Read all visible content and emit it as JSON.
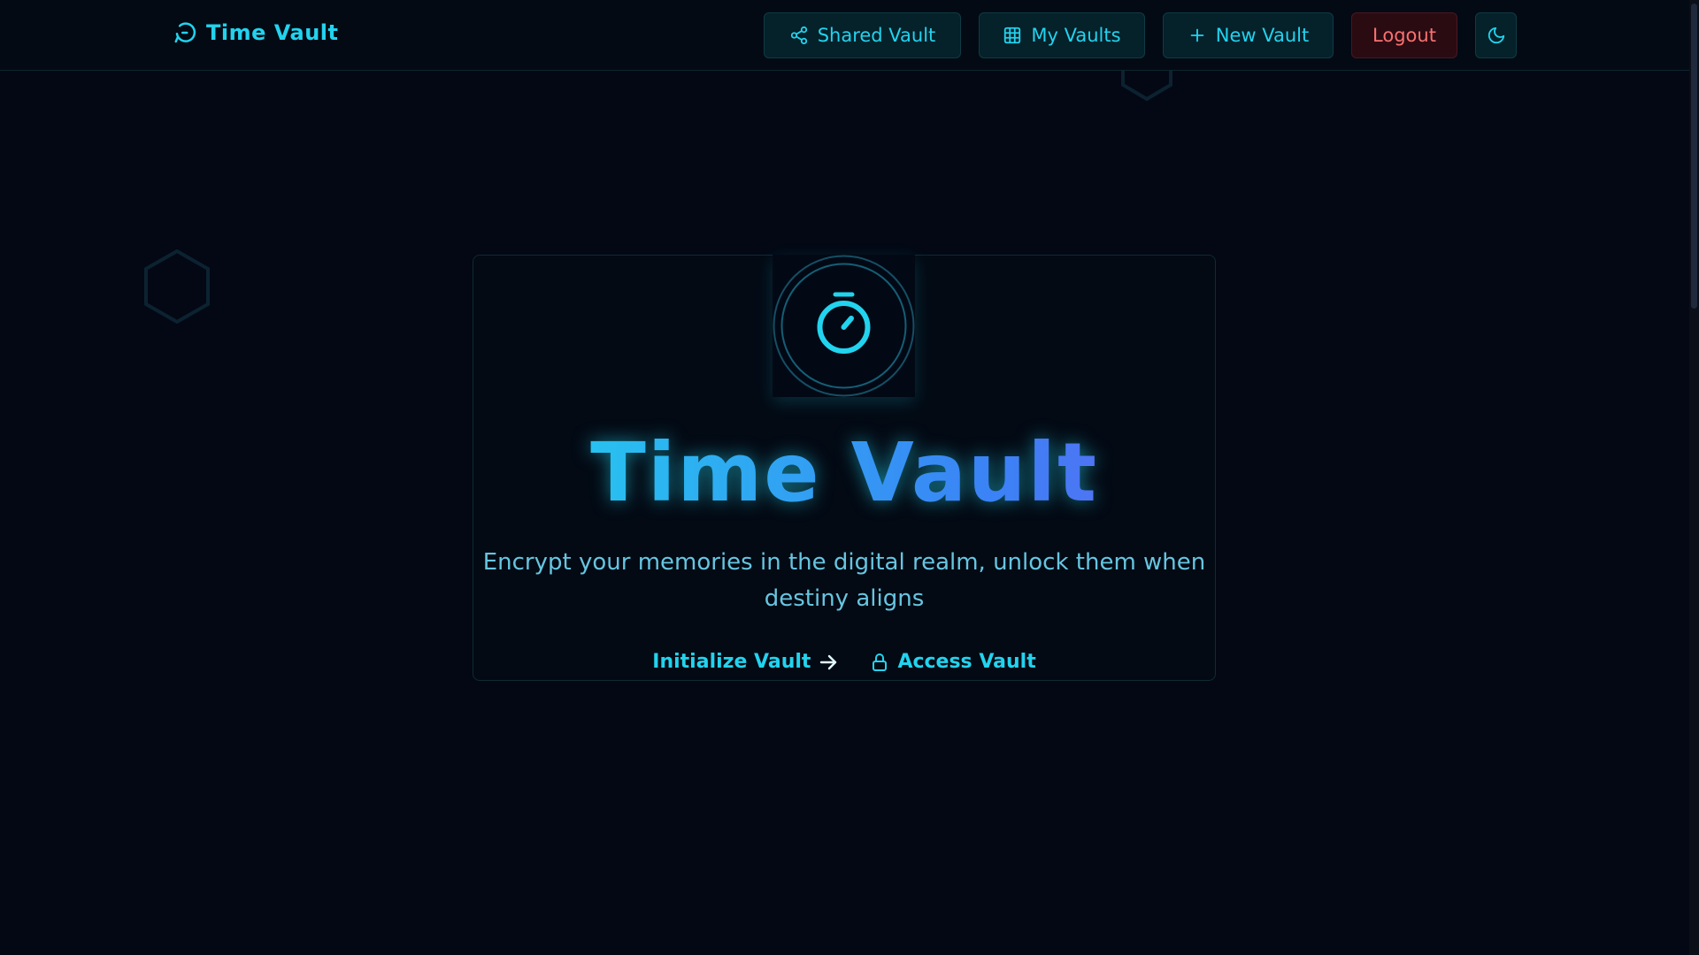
{
  "brand": {
    "name": "Time Vault",
    "icon": "clock-rotate-icon"
  },
  "nav": {
    "shared_vault": "Shared Vault",
    "my_vaults": "My Vaults",
    "new_vault": "New Vault",
    "logout": "Logout",
    "theme_icon": "moon-icon"
  },
  "hero": {
    "icon": "stopwatch-icon",
    "title": "Time Vault",
    "subtitle": "Encrypt your memories in the digital realm, unlock them when destiny aligns",
    "primary_action": "Initialize Vault",
    "secondary_action": "Access Vault"
  },
  "colors": {
    "accent": "#22d3ee",
    "background": "#030814",
    "danger": "#f87171",
    "gradient_end": "#6366f1"
  }
}
